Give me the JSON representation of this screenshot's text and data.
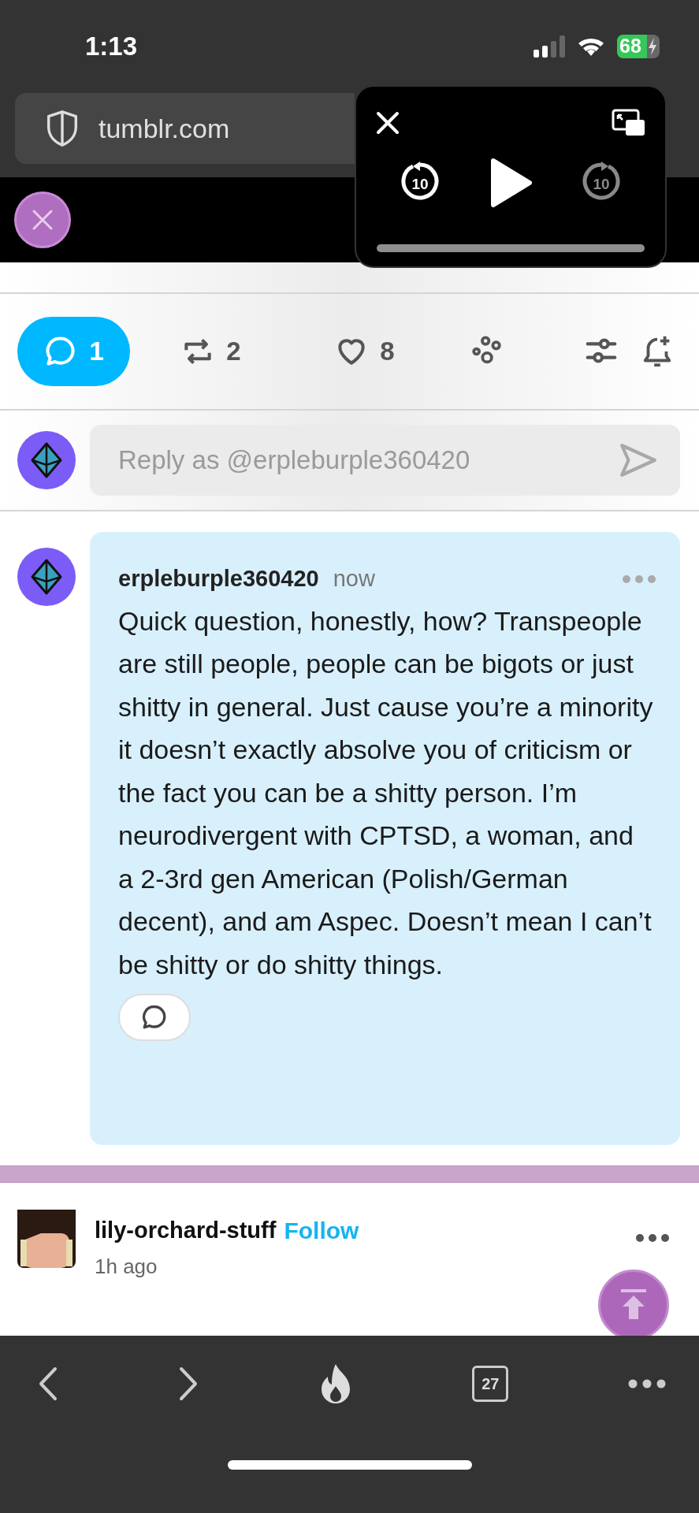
{
  "status_bar": {
    "time": "1:13",
    "battery": "68"
  },
  "browser": {
    "url": "tumblr.com"
  },
  "video_player": {
    "rewind_label": "10",
    "forward_label": "10",
    "forward_disabled": true
  },
  "actions": [
    {
      "kind": "reply",
      "count": "1",
      "selected": true
    },
    {
      "kind": "reblog",
      "count": "2",
      "selected": false
    },
    {
      "kind": "like",
      "count": "8",
      "selected": false
    },
    {
      "kind": "community"
    },
    {
      "kind": "filter"
    },
    {
      "kind": "notify"
    }
  ],
  "reply_field": {
    "placeholder": "Reply as @erpleburple360420"
  },
  "comment": {
    "author": "erpleburple360420",
    "time": "now",
    "text": "Quick question, honestly, how? Transpeople are still people, people can be bigots or just shitty in general. Just cause you’re a minority it doesn’t exactly absolve you of criticism or the fact you can be a shitty person. I’m neurodivergent with CPTSD, a woman, and a 2-3rd gen American (Polish/German decent), and am Aspec. Doesn’t mean I can’t be shitty or do shitty things.",
    "highlighted": true
  },
  "next_post": {
    "author": "lily-orchard-stuff",
    "follow": "Follow",
    "time": "1h ago"
  },
  "toolbar": {
    "tabs_count": "27"
  }
}
